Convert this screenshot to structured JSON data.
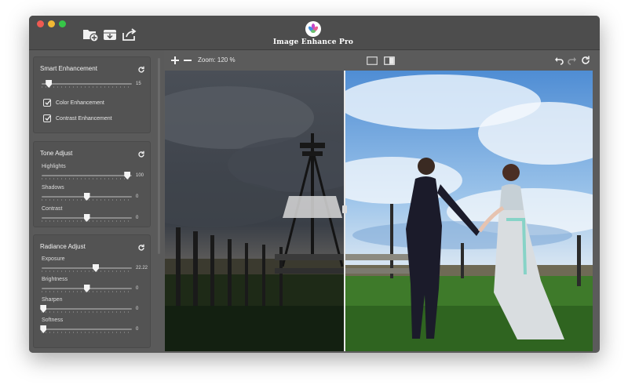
{
  "app": {
    "title": "Image Enhance Pro",
    "logo_icon": "flower-logo-icon"
  },
  "titlebar_icons": [
    "add-folder-icon",
    "save-tray-icon",
    "share-export-icon"
  ],
  "toolbar": {
    "zoom_in_icon": "plus-icon",
    "zoom_out_icon": "minus-icon",
    "zoom_label": "Zoom: 120 %",
    "view_single_icon": "single-view-icon",
    "view_split_icon": "split-view-icon",
    "undo_icon": "undo-icon",
    "redo_icon": "redo-icon",
    "reset_icon": "reset-icon"
  },
  "smart_enhancement": {
    "title": "Smart Enhancement",
    "slider_value": "15",
    "slider_fraction": 0.08,
    "checks": [
      {
        "label": "Color Enhancement",
        "checked": true
      },
      {
        "label": "Contrast Enhancement",
        "checked": true
      }
    ]
  },
  "tone_adjust": {
    "title": "Tone Adjust",
    "sliders": [
      {
        "label": "Highlights",
        "value": "100",
        "fraction": 0.95
      },
      {
        "label": "Shadows",
        "value": "0",
        "fraction": 0.5
      },
      {
        "label": "Contrast",
        "value": "0",
        "fraction": 0.5
      }
    ]
  },
  "radiance_adjust": {
    "title": "Radiance Adjust",
    "sliders": [
      {
        "label": "Exposure",
        "value": "22.22",
        "fraction": 0.6
      },
      {
        "label": "Brightness",
        "value": "0",
        "fraction": 0.5
      },
      {
        "label": "Sharpen",
        "value": "0",
        "fraction": 0.02
      },
      {
        "label": "Softness",
        "value": "0",
        "fraction": 0.02
      }
    ]
  },
  "colors": {
    "accent": "#ffffff",
    "panel": "#535353",
    "window": "#5b5b5b"
  }
}
